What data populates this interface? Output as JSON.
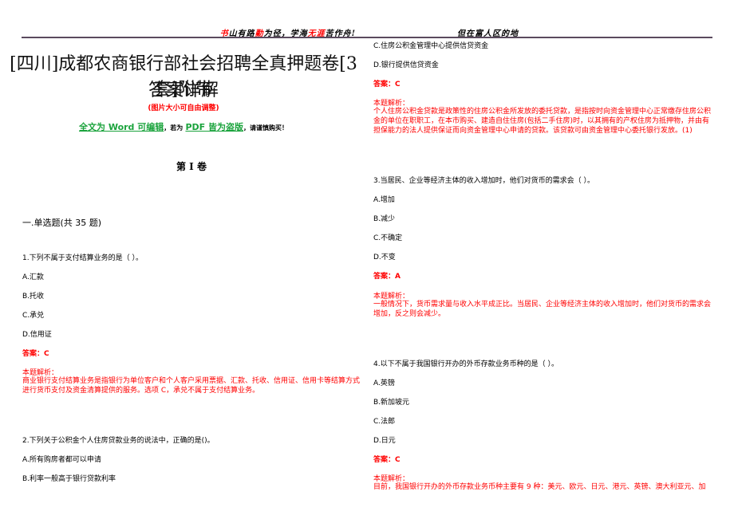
{
  "header": {
    "left_motto": [
      {
        "text": "书",
        "red": true
      },
      {
        "text": "山有路",
        "red": false
      },
      {
        "text": "勤",
        "red": true
      },
      {
        "text": "为径，学海",
        "red": false
      },
      {
        "text": "无涯",
        "red": true
      },
      {
        "text": "苦作舟!",
        "red": false
      }
    ],
    "right_motto": "但在富人区的地"
  },
  "document": {
    "title_line1": "[四川]成都农商银行部社会招聘全真押题卷[3套]附带",
    "title_line2": "答案详解",
    "subtitle": "(图片大小可自由调整)",
    "notice": {
      "part1": "全文为 Word 可编辑",
      "part2": "，若为",
      "part3": "PDF 皆为盗版",
      "part4": "，请谨慎购买！"
    },
    "volume": "第 I 卷",
    "section": "一.单选题(共 35 题)"
  },
  "left_questions": {
    "q1": {
      "stem": "1.下列不属于支付结算业务的是（    ）。",
      "options": [
        "A.汇款",
        "B.托收",
        "C.承兑",
        "D.信用证"
      ],
      "answer": "答案：C",
      "explanation_label": "本题解析：",
      "explanation": "商业银行支付结算业务是指银行为单位客户和个人客户采用票据、汇款、托收、信用证、信用卡等结算方式进行货币支付及资金清算提供的服务。选项 C，承兑不属于支付结算业务。"
    },
    "q2": {
      "stem": "2.下列关于公积金个人住房贷款业务的说法中，正确的是()。",
      "options": [
        "A.所有购房者都可以申请",
        "B.利率一般高于银行贷款利率"
      ]
    }
  },
  "right_questions": {
    "q2_cont": {
      "options": [
        "C.住房公积金管理中心提供信贷资金",
        "D.银行提供信贷资金"
      ],
      "answer": "答案：C",
      "explanation_label": "本题解析：",
      "explanation": "个人住房公积金贷款是政策性的住房公积金所发放的委托贷款，是指按时向资金管理中心正常缴存住房公积金的单位在职职工，在本市购买、建造自住住房(包括二手住房)时，以其拥有的产权住房为抵押物，并由有担保能力的法人提供保证而向资金管理中心申请的贷款。该贷款可由资金管理中心委托银行发放。(1)"
    },
    "q3": {
      "stem": "3.当居民、企业等经济主体的收入增加时，他们对货币的需求会（     ）。",
      "options": [
        "A.增加",
        "B.减少",
        "C.不确定",
        "D.不变"
      ],
      "answer": "答案：A",
      "explanation_label": "本题解析：",
      "explanation": "一般情况下，货币需求量与收入水平成正比。当居民、企业等经济主体的收入增加时，他们对货币的需求会增加，反之则会减少。"
    },
    "q4": {
      "stem": "4.以下不属于我国银行开办的外币存款业务币种的是（ ）。",
      "options": [
        "A.英镑",
        "B.新加坡元",
        "C.法郎",
        "D.日元"
      ],
      "answer": "答案：C",
      "explanation_label": "本题解析：",
      "explanation": "目前，我国银行开办的外币存款业务币种主要有 9 种：美元、欧元、日元、港元、英镑、澳大利亚元、加"
    }
  },
  "colors": {
    "answer_red": "#ff0000",
    "notice_green": "#1aa33c",
    "header_rule": "#5a4a5e"
  }
}
